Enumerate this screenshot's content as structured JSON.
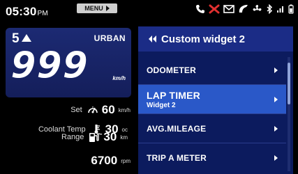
{
  "status_bar": {
    "time": "05:30",
    "ampm": "PM",
    "menu_label": "MENU",
    "icons": [
      "call-icon",
      "muted-icon",
      "message-icon",
      "navigation-icon",
      "fan-icon",
      "bluetooth-icon",
      "signal-icon",
      "battery-icon"
    ]
  },
  "cluster": {
    "gear": "5",
    "mode": "URBAN",
    "speed": "999",
    "speed_unit": "km/h",
    "set": {
      "label": "Set",
      "value": "60",
      "unit": "km/h",
      "icon": "cruise-control-icon"
    },
    "coolant": {
      "label": "Coolant Temp",
      "value": "30",
      "unit": "oc",
      "icon": "coolant-temp-icon"
    },
    "range": {
      "label": "Range",
      "value": "30",
      "unit": "km",
      "icon": "fuel-pump-icon"
    },
    "rpm": {
      "value": "6700",
      "unit": "rpm"
    }
  },
  "menu": {
    "title": "Custom widget 2",
    "items": [
      {
        "label": "ODOMETER",
        "sub": "",
        "selected": false
      },
      {
        "label": "LAP TIMER",
        "sub": "Widget 2",
        "selected": true
      },
      {
        "label": "AVG.MILEAGE",
        "sub": "",
        "selected": false
      },
      {
        "label": "TRIP A METER",
        "sub": "",
        "selected": false
      }
    ]
  },
  "colors": {
    "background": "#000000",
    "panel": "#141e5a",
    "menu_header": "#1b2c86",
    "selected_item": "#2a58c8",
    "alert": "#e03030"
  }
}
